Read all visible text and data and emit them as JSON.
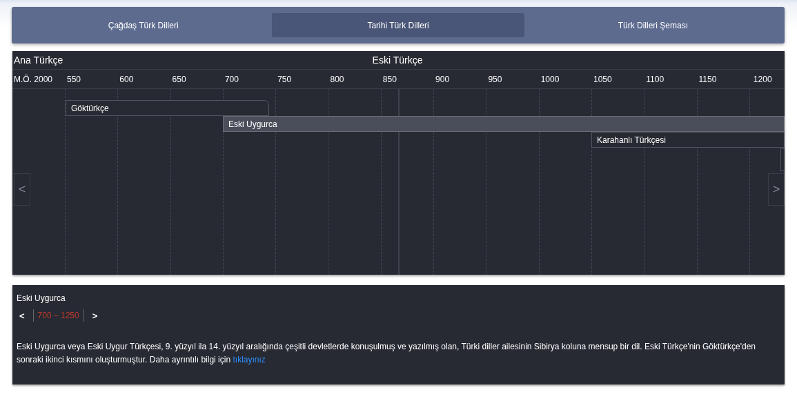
{
  "tabs": [
    {
      "label": "Çağdaş Türk Dilleri",
      "selected": false
    },
    {
      "label": "Tarihi Türk Dilleri",
      "selected": true
    },
    {
      "label": "Türk Dilleri Şeması",
      "selected": false
    }
  ],
  "timeline": {
    "eras": [
      "Ana Türkçe",
      "Eski Türkçe"
    ],
    "ticks": [
      "M.Ö. 2000",
      "550",
      "600",
      "650",
      "700",
      "750",
      "800",
      "850",
      "900",
      "950",
      "1000",
      "1050",
      "1100",
      "1150",
      "1200"
    ],
    "bars": [
      {
        "label": "Göktürkçe",
        "selected": false
      },
      {
        "label": "Eski Uygurca",
        "selected": true
      },
      {
        "label": "Karahanlı Türkçesi",
        "selected": false
      }
    ],
    "prev": "<",
    "next": ">"
  },
  "detail": {
    "title": "Eski Uygurca",
    "prev": "<",
    "range": "700 – 1250",
    "next": ">",
    "text": "Eski Uygurca veya Eski Uygur Türkçesi, 9. yüzyıl ila 14. yüzyıl aralığında çeşitli devletlerde konuşulmuş ve yazılmış olan, Türki diller ailesinin Sibirya koluna mensup bir dil. Eski Türkçe'nin Göktürkçe'den sonraki ikinci kısmını oluşturmuştur. Daha ayrıntılı bilgi için",
    "link": "tıklayınız"
  }
}
